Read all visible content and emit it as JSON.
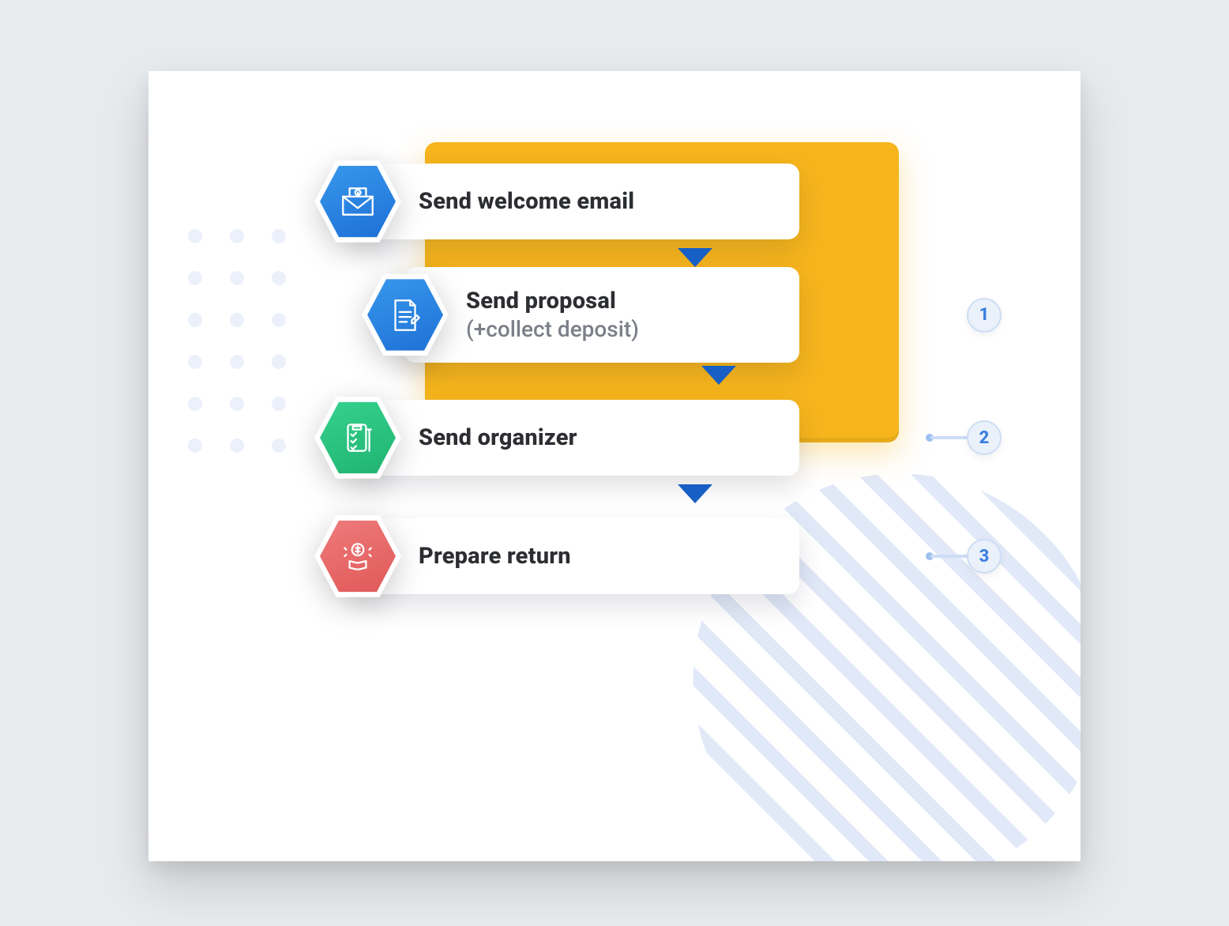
{
  "steps": [
    {
      "title": "Send welcome email",
      "subtitle": "",
      "icon": "mail-icon",
      "color": "blue",
      "badge": ""
    },
    {
      "title": "Send proposal",
      "subtitle": "(+collect deposit)",
      "icon": "document-icon",
      "color": "blue",
      "badge": "1"
    },
    {
      "title": "Send organizer",
      "subtitle": "",
      "icon": "checklist-icon",
      "color": "green",
      "badge": "2"
    },
    {
      "title": "Prepare return",
      "subtitle": "",
      "icon": "money-icon",
      "color": "red",
      "badge": "3"
    }
  ],
  "colors": {
    "accent_yellow": "#f6b51d",
    "accent_blue": "#1d6fd6",
    "badge_text": "#3b7fe0"
  }
}
